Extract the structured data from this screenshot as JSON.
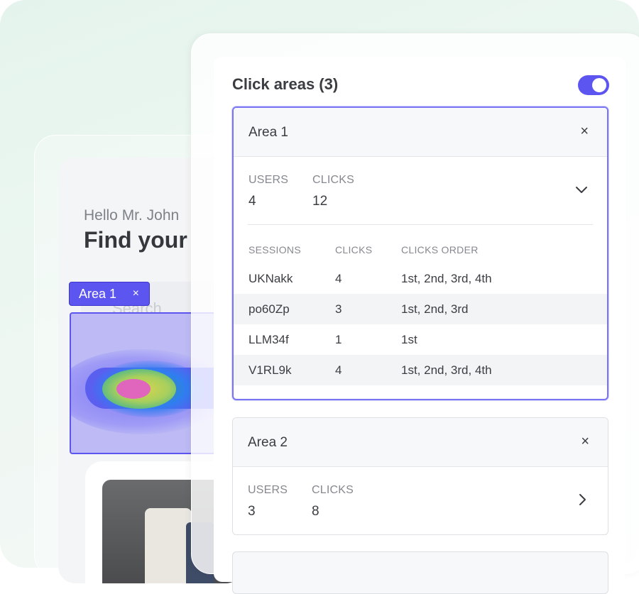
{
  "back_app": {
    "greeting": "Hello Mr. John",
    "heading": "Find your",
    "search_placeholder": "Search",
    "area_tag": {
      "label": "Area 1",
      "close": "×"
    }
  },
  "panel": {
    "title": "Click areas (3)",
    "toggle_on": true,
    "accent_color": "#5c55f0"
  },
  "areas": [
    {
      "name": "Area 1",
      "close": "×",
      "users_label": "USERS",
      "users": "4",
      "clicks_label": "CLICKS",
      "clicks": "12",
      "expanded": true,
      "sessions_header": {
        "session": "SESSIONS",
        "clicks": "CLICKS",
        "order": "CLICKS ORDER"
      },
      "sessions": [
        {
          "id": "UKNakk",
          "clicks": "4",
          "order": "1st, 2nd, 3rd, 4th"
        },
        {
          "id": "po60Zp",
          "clicks": "3",
          "order": "1st, 2nd, 3rd"
        },
        {
          "id": "LLM34f",
          "clicks": "1",
          "order": "1st"
        },
        {
          "id": "V1RL9k",
          "clicks": "4",
          "order": "1st, 2nd, 3rd, 4th"
        }
      ]
    },
    {
      "name": "Area 2",
      "close": "×",
      "users_label": "USERS",
      "users": "3",
      "clicks_label": "CLICKS",
      "clicks": "8",
      "expanded": false
    }
  ]
}
